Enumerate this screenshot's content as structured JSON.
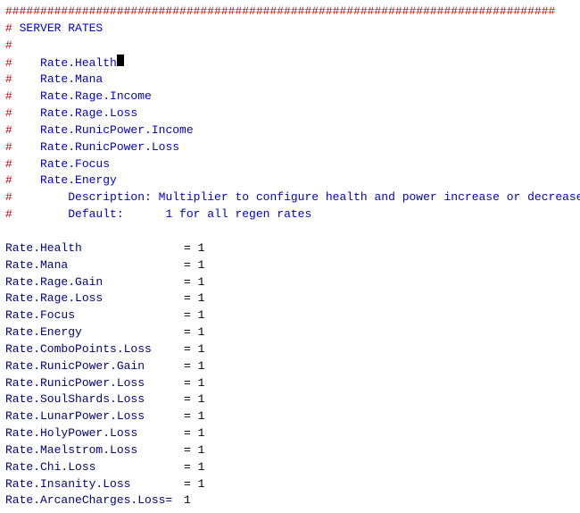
{
  "header": {
    "separator": "###############################################################################",
    "title": "# SERVER RATES",
    "hash_only": "#"
  },
  "commented_rates": [
    {
      "hash": "#",
      "indent": "    ",
      "key": "Rate.Health",
      "cursor": true
    },
    {
      "hash": "#",
      "indent": "    ",
      "key": "Rate.Mana",
      "cursor": false
    },
    {
      "hash": "#",
      "indent": "    ",
      "key": "Rate.Rage.Income",
      "cursor": false
    },
    {
      "hash": "#",
      "indent": "    ",
      "key": "Rate.Rage.Loss",
      "cursor": false
    },
    {
      "hash": "#",
      "indent": "    ",
      "key": "Rate.RunicPower.Income",
      "cursor": false
    },
    {
      "hash": "#",
      "indent": "    ",
      "key": "Rate.RunicPower.Loss",
      "cursor": false
    },
    {
      "hash": "#",
      "indent": "    ",
      "key": "Rate.Focus",
      "cursor": false
    },
    {
      "hash": "#",
      "indent": "    ",
      "key": "Rate.Energy",
      "cursor": false
    }
  ],
  "description": {
    "hash": "#",
    "desc_label": "        Description:",
    "desc_value": " Multiplier to configure health and power increase or decrease."
  },
  "default_line": {
    "hash": "#",
    "default_label": "        Default:",
    "default_value": "      1 for all regen rates"
  },
  "rates": [
    {
      "key": "Rate.Health",
      "spaces": "            ",
      "eq": "= 1"
    },
    {
      "key": "Rate.Mana",
      "spaces": "              ",
      "eq": "= 1"
    },
    {
      "key": "Rate.Rage.Gain",
      "spaces": "          ",
      "eq": "= 1"
    },
    {
      "key": "Rate.Rage.Loss",
      "spaces": "          ",
      "eq": "= 1"
    },
    {
      "key": "Rate.Focus",
      "spaces": "             ",
      "eq": "= 1"
    },
    {
      "key": "Rate.Energy",
      "spaces": "            ",
      "eq": "= 1"
    },
    {
      "key": "Rate.ComboPoints.Loss",
      "spaces": "   ",
      "eq": "= 1"
    },
    {
      "key": "Rate.RunicPower.Gain",
      "spaces": "    ",
      "eq": "= 1"
    },
    {
      "key": "Rate.RunicPower.Loss",
      "spaces": "    ",
      "eq": "= 1"
    },
    {
      "key": "Rate.SoulShards.Loss",
      "spaces": "    ",
      "eq": "= 1"
    },
    {
      "key": "Rate.LunarPower.Loss",
      "spaces": "    ",
      "eq": "= 1"
    },
    {
      "key": "Rate.HolyPower.Loss",
      "spaces": "     ",
      "eq": "= 1"
    },
    {
      "key": "Rate.Maelstrom.Loss",
      "spaces": "     ",
      "eq": "= 1"
    },
    {
      "key": "Rate.Chi.Loss",
      "spaces": "           ",
      "eq": "= 1"
    },
    {
      "key": "Rate.Insanity.Loss",
      "spaces": "      ",
      "eq": "= 1"
    },
    {
      "key": "Rate.ArcaneCharges.Loss=",
      "spaces": " ",
      "eq": "1"
    }
  ]
}
